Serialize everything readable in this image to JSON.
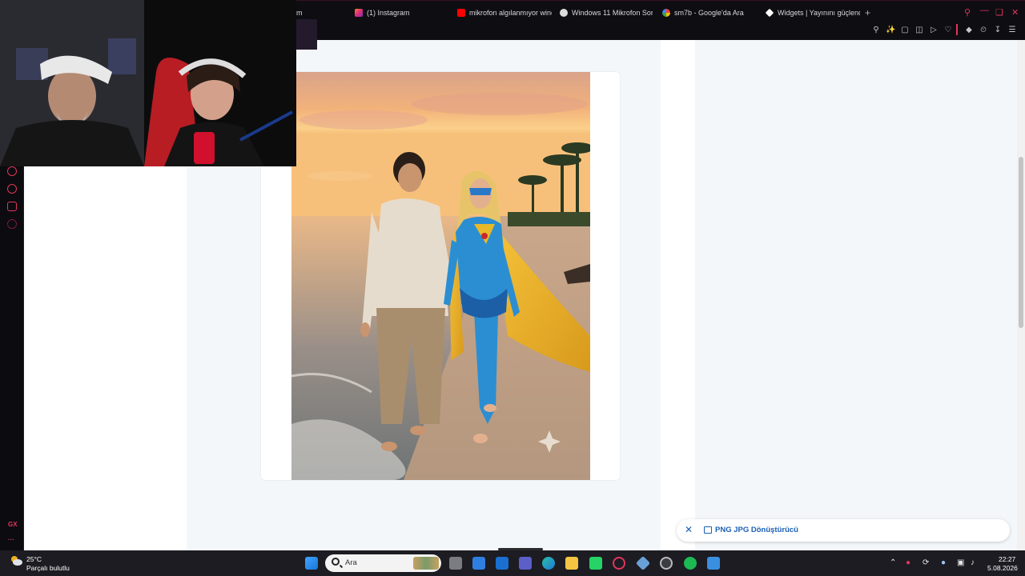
{
  "browser": {
    "tabs": [
      {
        "label": "m",
        "icon": "tab-fragment"
      },
      {
        "label": "(1) Instagram",
        "icon": "instagram-icon",
        "color": "#d6249f"
      },
      {
        "label": "mikrofon algılanmıyor wind",
        "icon": "youtube-icon",
        "color": "#ff0000"
      },
      {
        "label": "Windows 11 Mikrofon Soru",
        "icon": "windows-forum-icon",
        "color": "#dcdcdc"
      },
      {
        "label": "sm7b - Google'da Ara",
        "icon": "google-icon",
        "color": "#4285f4"
      },
      {
        "label": "Widgets | Yayınını güçlend",
        "icon": "widgets-icon",
        "color": "#ffffff"
      }
    ],
    "accent": "#e0365c"
  },
  "sidebar": {
    "icons": [
      "player-icon",
      "history-icon",
      "extensions-icon",
      "settings-icon"
    ],
    "gx_label": "GX",
    "more_label": "···"
  },
  "toast": {
    "label": "PNG JPG Dönüştürücü"
  },
  "taskbar": {
    "weather": {
      "temp": "25°C",
      "condition": "Parçalı bulutlu"
    },
    "search_placeholder": "Ara",
    "clock": {
      "time": "22:27",
      "date": "5.08.2026"
    },
    "apps": [
      "windows-start-icon",
      "search-icon",
      "file-explorer-icon",
      "store-icon",
      "mail-icon",
      "teams-icon",
      "edge-icon",
      "folder-icon",
      "whatsapp-icon",
      "opera-gx-icon",
      "app-icon",
      "obs-icon",
      "spotify-icon",
      "help-icon"
    ]
  }
}
